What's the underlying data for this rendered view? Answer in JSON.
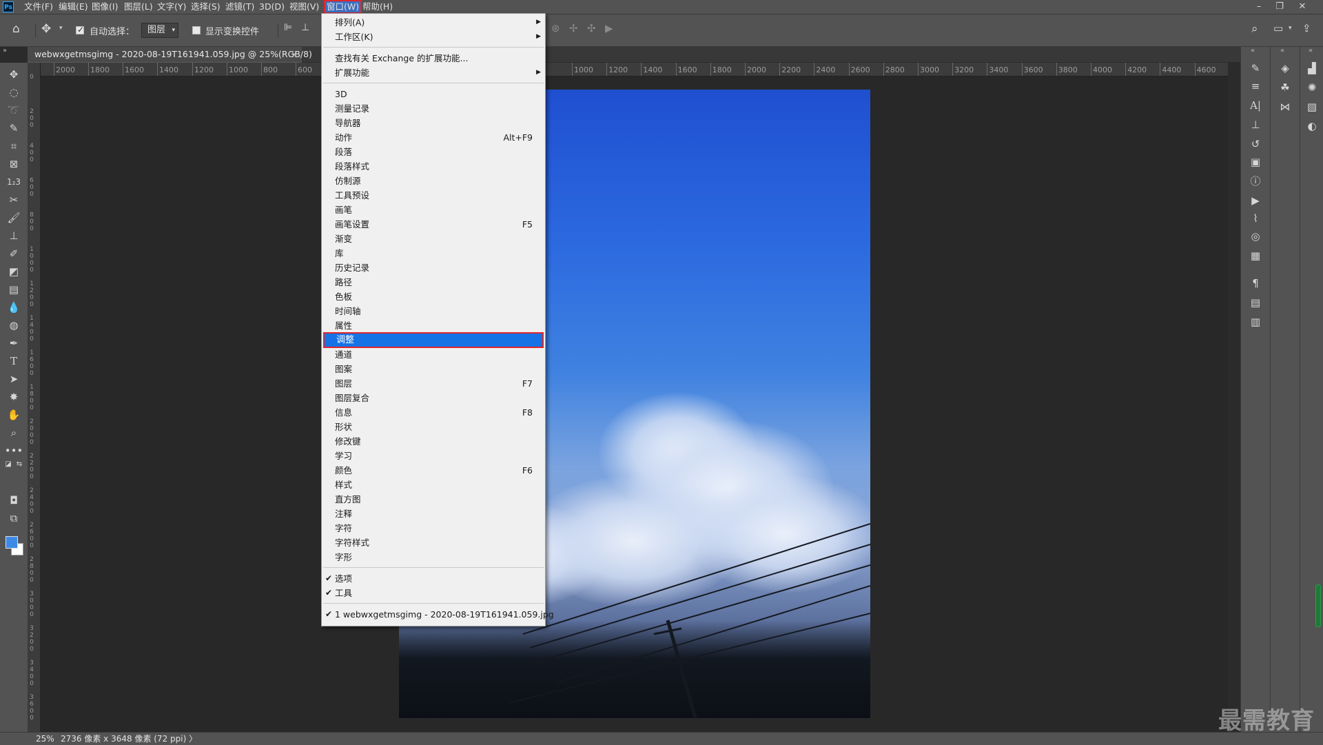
{
  "app": {
    "logo": "Ps"
  },
  "menubar": {
    "items": [
      "文件(F)",
      "编辑(E)",
      "图像(I)",
      "图层(L)",
      "文字(Y)",
      "选择(S)",
      "滤镜(T)",
      "3D(D)",
      "视图(V)",
      "窗口(W)",
      "帮助(H)"
    ],
    "active": "窗口(W)"
  },
  "window_controls": {
    "minimize": "–",
    "restore": "❐",
    "close": "✕"
  },
  "options": {
    "auto_select_label": "自动选择：",
    "auto_select_checked": true,
    "layer_select_value": "图层",
    "show_transform_label": "显示变换控件",
    "show_transform_checked": false
  },
  "document": {
    "tab_title": "webwxgetmsgimg - 2020-08-19T161941.059.jpg @ 25%(RGB/8)",
    "close_glyph": "×"
  },
  "ruler": {
    "left_labels": [
      "2000",
      "1800",
      "1600",
      "1400",
      "1200",
      "1000",
      "800",
      "600"
    ],
    "right_labels": [
      "1000",
      "1200",
      "1400",
      "1600",
      "1800",
      "2000",
      "2200",
      "2400",
      "2600",
      "2800",
      "3000",
      "3200",
      "3400",
      "3600",
      "3800",
      "4000",
      "4200",
      "4400",
      "4600"
    ],
    "vertical_labels": [
      "0",
      "2 0 0",
      "4 0 0",
      "6 0 0",
      "8 0 0",
      "1 0 0 0",
      "1 2 0 0",
      "1 4 0 0",
      "1 6 0 0",
      "1 8 0 0",
      "2 0 0 0",
      "2 2 0 0",
      "2 4 0 0",
      "2 6 0 0",
      "2 8 0 0",
      "3 0 0 0",
      "3 2 0 0",
      "3 4 0 0",
      "3 6 0 0"
    ]
  },
  "window_menu": {
    "items": [
      {
        "label": "排列(A)",
        "submenu": true
      },
      {
        "label": "工作区(K)",
        "submenu": true
      },
      {
        "separator": true
      },
      {
        "label": "查找有关 Exchange 的扩展功能..."
      },
      {
        "label": "扩展功能",
        "submenu": true
      },
      {
        "separator": true
      },
      {
        "label": "3D"
      },
      {
        "label": "测量记录"
      },
      {
        "label": "导航器"
      },
      {
        "label": "动作",
        "shortcut": "Alt+F9"
      },
      {
        "label": "段落"
      },
      {
        "label": "段落样式"
      },
      {
        "label": "仿制源"
      },
      {
        "label": "工具预设"
      },
      {
        "label": "画笔"
      },
      {
        "label": "画笔设置",
        "shortcut": "F5"
      },
      {
        "label": "渐变"
      },
      {
        "label": "库"
      },
      {
        "label": "历史记录"
      },
      {
        "label": "路径"
      },
      {
        "label": "色板"
      },
      {
        "label": "时间轴"
      },
      {
        "label": "属性"
      },
      {
        "label": "调整",
        "highlighted": true
      },
      {
        "label": "通道"
      },
      {
        "label": "图案"
      },
      {
        "label": "图层",
        "shortcut": "F7"
      },
      {
        "label": "图层复合"
      },
      {
        "label": "信息",
        "shortcut": "F8"
      },
      {
        "label": "形状"
      },
      {
        "label": "修改键"
      },
      {
        "label": "学习"
      },
      {
        "label": "颜色",
        "shortcut": "F6"
      },
      {
        "label": "样式"
      },
      {
        "label": "直方图"
      },
      {
        "label": "注释"
      },
      {
        "label": "字符"
      },
      {
        "label": "字符样式"
      },
      {
        "label": "字形"
      },
      {
        "separator": true
      },
      {
        "label": "选项",
        "checked": true
      },
      {
        "label": "工具",
        "checked": true
      },
      {
        "separator": true
      },
      {
        "label": "1 webwxgetmsgimg - 2020-08-19T161941.059.jpg",
        "checked": true
      }
    ]
  },
  "colors": {
    "foreground": "#3d8ae6",
    "background": "#ffffff",
    "highlight": "#1673e6",
    "annotation_red": "#e0262b"
  },
  "status": {
    "zoom": "25%",
    "dimensions": "2736 像素 x 3648 像素 (72 ppi)",
    "arrow": "〉"
  },
  "watermark": "最需教育"
}
